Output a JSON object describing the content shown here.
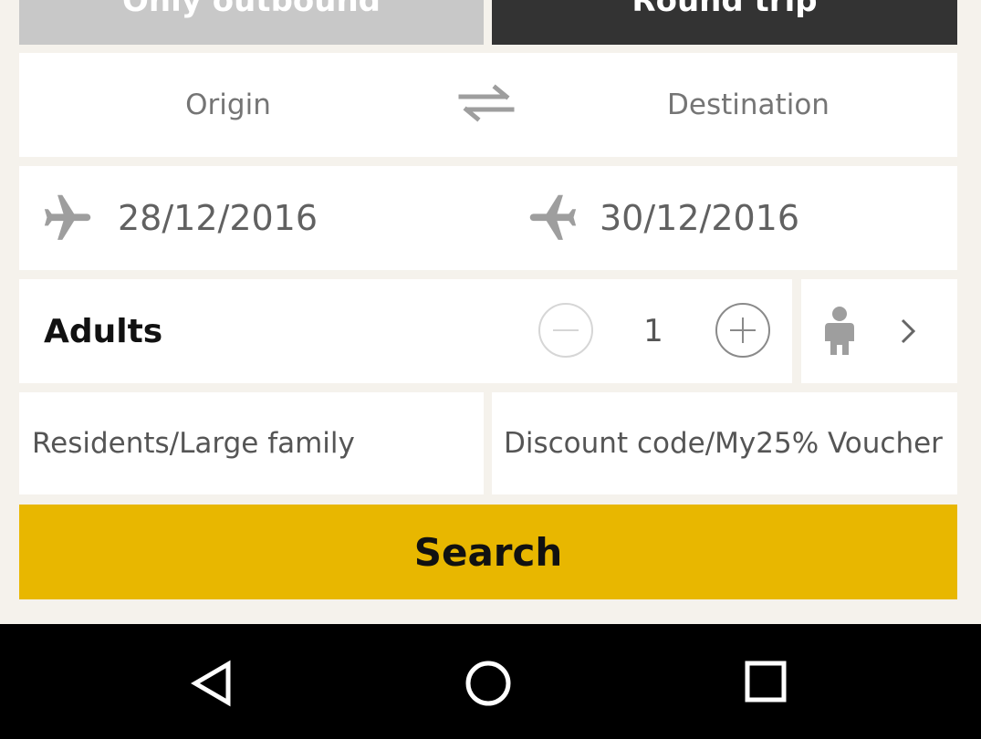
{
  "trip_type": {
    "outbound_label": "Only outbound",
    "round_label": "Round trip",
    "selected": "Round trip"
  },
  "route": {
    "origin_placeholder": "Origin",
    "destination_placeholder": "Destination",
    "swap_icon": "swap-arrows-icon"
  },
  "dates": {
    "departure": "28/12/2016",
    "return": "30/12/2016",
    "departure_icon": "plane-takeoff-icon",
    "return_icon": "plane-landing-icon"
  },
  "passengers": {
    "adults_label": "Adults",
    "adults_count": "1",
    "decrement_icon": "minus-circle-icon",
    "increment_icon": "plus-circle-icon",
    "child_icon": "child-icon",
    "chevron_icon": "chevron-right-icon"
  },
  "options": {
    "residents_label": "Residents/Large family",
    "discount_label": "Discount code/My25% Voucher"
  },
  "search_label": "Search",
  "colors": {
    "accent": "#e8b700",
    "selected_tab": "#333333",
    "unselected_tab": "#c8c8c8",
    "background": "#f5f2ec"
  },
  "nav_bar": {
    "back_icon": "back-triangle-icon",
    "home_icon": "home-circle-icon",
    "recents_icon": "recents-square-icon"
  }
}
